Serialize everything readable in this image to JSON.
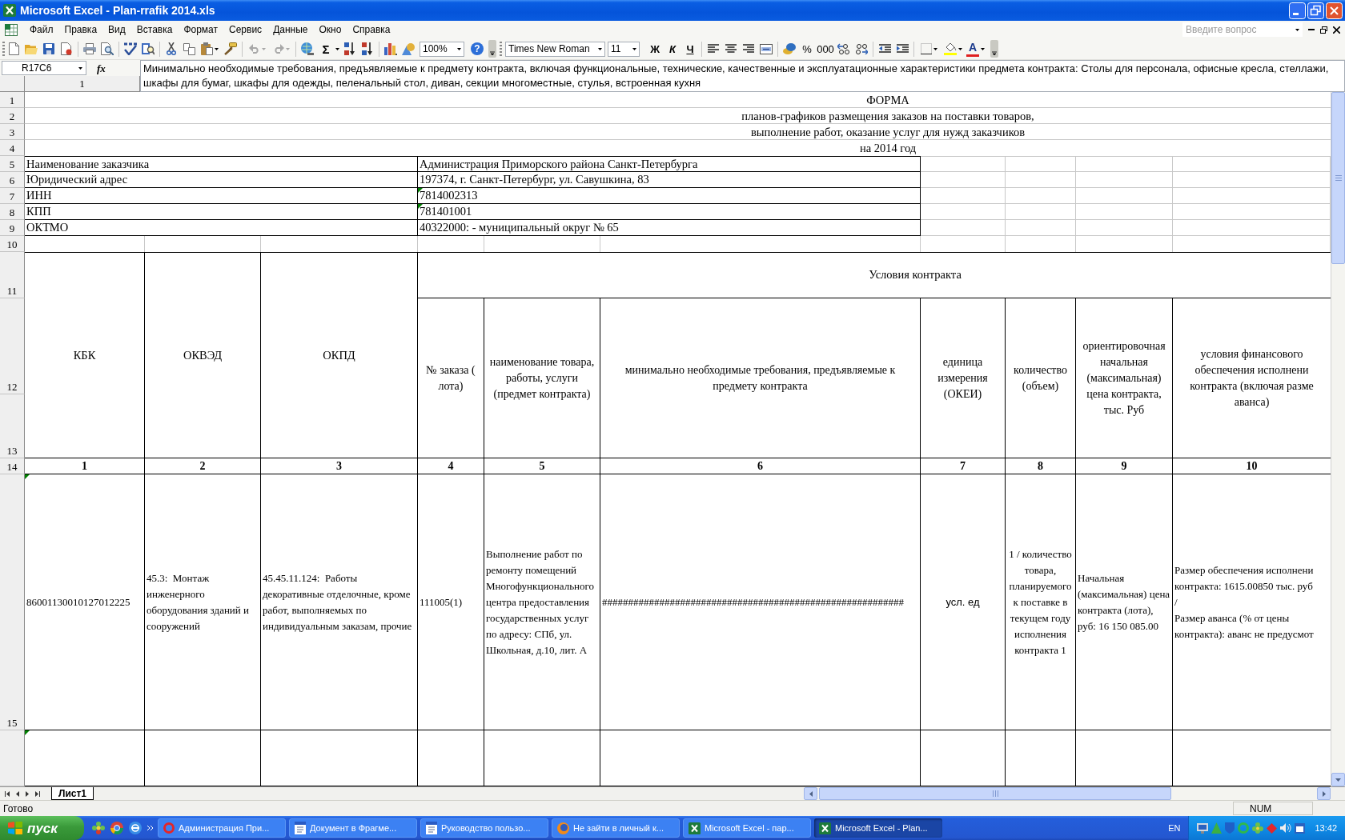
{
  "window": {
    "title": "Microsoft Excel - Plan-rrafik 2014.xls"
  },
  "menu": [
    "Файл",
    "Правка",
    "Вид",
    "Вставка",
    "Формат",
    "Сервис",
    "Данные",
    "Окно",
    "Справка"
  ],
  "help_search": {
    "placeholder": "Введите вопрос"
  },
  "toolbar": {
    "undo": {
      "disabled": true
    },
    "redo": {
      "disabled": true
    },
    "sum": "Σ",
    "zoom": "100%",
    "help": "?",
    "font": "Times New Roman",
    "font_size": "11",
    "style_buttons": [
      "Ж",
      "К",
      "Ч"
    ],
    "percent": "%",
    "thousands": "000",
    "font_color": "A"
  },
  "formula_bar": {
    "name_box": "R17C6",
    "function_label": "fx",
    "formula": "Минимально необходимые требования, предъявляемые к предмету контракта, включая функциональные, технические, качественные и эксплуатационные характеристики предмета контракта: Столы для персонала, офисные кресла, стеллажи, шкафы для бумаг, шкафы для одежды, пеленальный стол, диван, секции многоместные, стулья, встроенная кухня"
  },
  "column_headers": [
    "1"
  ],
  "sheet": {
    "row_numbers": [
      "1",
      "2",
      "3",
      "4",
      "5",
      "6",
      "7",
      "8",
      "9",
      "10",
      "11",
      "12",
      "13",
      "14",
      "15"
    ],
    "title_lines": [
      "ФОРМА",
      "планов-графиков размещения заказов на поставки товаров,",
      "выполнение работ, оказание услуг для нужд заказчиков",
      "на 2014 год"
    ],
    "customer_info": [
      {
        "label": "Наименование заказчика",
        "value": "Администрация Приморского района Санкт-Петербурга",
        "flagged": false
      },
      {
        "label": "Юридический адрес",
        "value": "197374, г. Санкт-Петербург, ул. Савушкина, 83",
        "flagged": false
      },
      {
        "label": "ИНН",
        "value": "7814002313",
        "flagged": true
      },
      {
        "label": "КПП",
        "value": "781401001",
        "flagged": true
      },
      {
        "label": "ОКТМО",
        "value": "40322000: - муниципальный округ № 65",
        "flagged": false
      }
    ],
    "group_header": "Условия контракта",
    "columns": [
      {
        "heading": "КБК",
        "number": "1"
      },
      {
        "heading": "ОКВЭД",
        "number": "2"
      },
      {
        "heading": "ОКПД",
        "number": "3"
      },
      {
        "heading": "№ заказа ( лота)",
        "number": "4"
      },
      {
        "heading": "наименование товара, работы, услуги (предмет контракта)",
        "number": "5"
      },
      {
        "heading": "минимально необходимые требования, предъявляемые к предмету контракта",
        "number": "6"
      },
      {
        "heading": "единица измерения (ОКЕИ)",
        "number": "7"
      },
      {
        "heading": "количество (объем)",
        "number": "8"
      },
      {
        "heading": "ориентировочная начальная (максимальная) цена контракта, тыс. Руб",
        "number": "9"
      },
      {
        "heading": "условия финансового\nобеспечения исполнени\nконтракта (включая разме\nаванса)",
        "number": "10"
      }
    ],
    "rows": [
      {
        "flagged": true,
        "cells": [
          "86001130010127012225",
          "45.3:  Монтаж инженерного оборудования зданий и сооружений",
          "45.45.11.124:  Работы декоративные отделочные, кроме работ, выполняемых по индивидуальным заказам, прочие",
          "111005(1)",
          "Выполнение работ по ремонту помещений Многофункционального центра предоставления государственных услуг по адресу: СПб, ул. Школьная, д.10, лит. А",
          "##########################################################",
          "усл. ед",
          "1 / количество товара, планируемого к поставке в текущем году исполнения контракта 1",
          "Начальная (максимальная) цена контракта (лота), руб: 16 150 085.00",
          "Размер обеспечения исполнени\nконтракта: 1615.00850 тыс. руб\n/\nРазмер аванса (% от цены\nконтракта): аванс не предусмот"
        ]
      },
      {
        "flagged": true
      }
    ]
  },
  "sheet_tabs": [
    {
      "label": "Лист1",
      "selected": true
    }
  ],
  "status_bar": {
    "message": "Готово",
    "indicator": "NUM"
  },
  "taskbar": {
    "start": "пуск",
    "tasks": [
      {
        "label": "Администрация При...",
        "kind": "ring",
        "selected": false
      },
      {
        "label": "Документ в Фрагме...",
        "kind": "document",
        "selected": false
      },
      {
        "label": "Руководство пользо...",
        "kind": "document",
        "selected": false
      },
      {
        "label": "Не зайти в личный к...",
        "kind": "globe",
        "selected": false
      },
      {
        "label": "Microsoft Excel - пар...",
        "kind": "sheet",
        "selected": false
      },
      {
        "label": "Microsoft Excel - Plan...",
        "kind": "sheet",
        "selected": true
      }
    ],
    "language": "EN",
    "clock": "13:42"
  }
}
